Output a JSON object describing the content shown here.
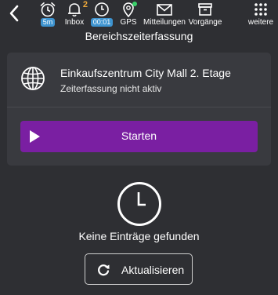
{
  "toolbar": {
    "timer_pill": "5m",
    "inbox_label": "Inbox",
    "inbox_badge": "2",
    "clock_pill": "00:01",
    "gps_label": "GPS",
    "messages_label": "Mitteilungen",
    "processes_label": "Vorgänge",
    "more_label": "weitere"
  },
  "page": {
    "title": "Bereichszeiterfassung"
  },
  "location": {
    "name": "Einkaufszentrum City Mall 2. Etage",
    "status": "Zeiterfassung nicht aktiv"
  },
  "actions": {
    "start_label": "Starten",
    "refresh_label": "Aktualisieren"
  },
  "empty_state": {
    "message": "Keine Einträge gefunden"
  },
  "colors": {
    "background": "#2e2f33",
    "card": "#393a3f",
    "accent": "#7a1fa2",
    "pill": "#3d93cf",
    "badge": "#f0a93b",
    "gps_ok": "#3ad06a"
  },
  "icons": {
    "back": "chevron-left-icon",
    "timer": "alarm-clock-icon",
    "inbox": "bell-icon",
    "clock": "clock-icon",
    "gps": "map-pin-icon",
    "messages": "envelope-icon",
    "processes": "archive-box-icon",
    "more": "grid-dots-icon",
    "location": "globe-icon",
    "start": "play-icon",
    "empty": "clock-icon",
    "refresh": "refresh-icon"
  }
}
